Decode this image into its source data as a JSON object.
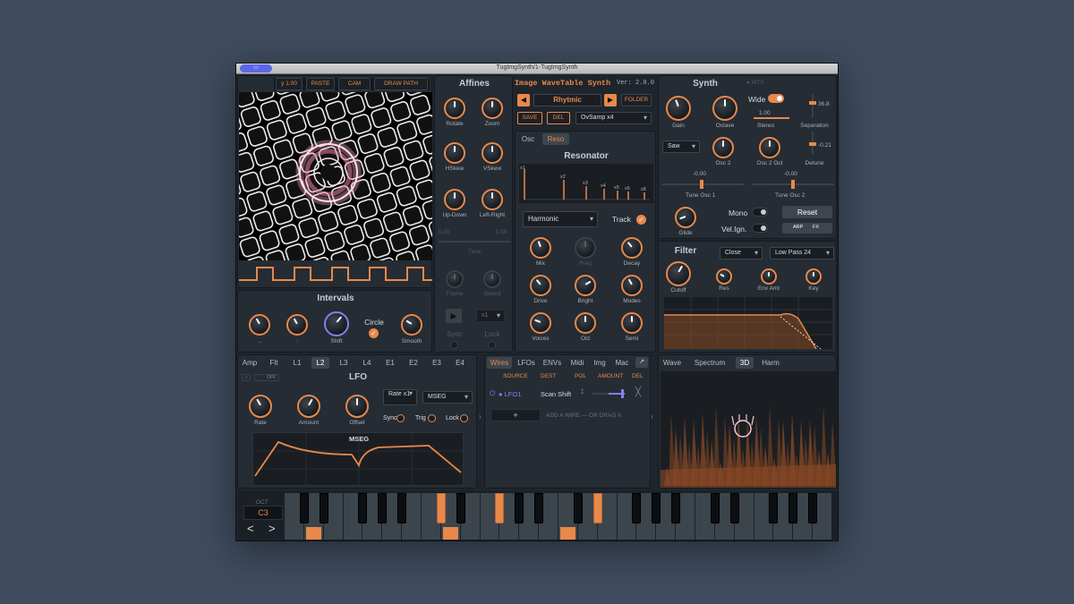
{
  "window": {
    "title": "TugImgSynth/1-TugImgSynth",
    "icon": "app-icon"
  },
  "image_panel": {
    "scale_value": "y 1.00",
    "buttons": [
      "PASTE",
      "CAM",
      "DRAW PATH"
    ]
  },
  "intervals": {
    "title": "Intervals",
    "knobs": [
      "..",
      ":",
      "Shift",
      "Smooth"
    ],
    "circle_label": "Circle"
  },
  "affines": {
    "title": "Affines",
    "knobs": [
      "Rotate",
      "Zoom",
      "HSkew",
      "VSkew",
      "Up-Down",
      "Left-Right"
    ],
    "slider_min": "0.00",
    "slider_max": "1.00",
    "slider_label": "Time",
    "dim_knobs": [
      "Frame",
      "Speed"
    ],
    "multiplier": "x1",
    "sync_label": "Sync",
    "lock_label": "Lock"
  },
  "header": {
    "name": "Image WaveTable Synth",
    "version": "Ver: 2.0.0",
    "preset": "Rhytmic",
    "folder_label": "FOLDER",
    "save_label": "SAVE",
    "del_label": "DEL",
    "oversample": "OvSamp x4"
  },
  "osc_tabs": [
    "Osc",
    "Reso"
  ],
  "resonator": {
    "title": "Resonator",
    "harmonic_labels": [
      "x1",
      "x2",
      "x3",
      "x4",
      "x5",
      "x6",
      "x8"
    ],
    "mode": "Harmonic",
    "track_label": "Track",
    "knobs": [
      "Mix",
      "Freq",
      "Decay",
      "Drive",
      "Bright",
      "Modes",
      "Voices",
      "Oct",
      "Semi"
    ]
  },
  "synth": {
    "title": "Synth",
    "mts_label": "MTS",
    "knobs": [
      "Gain",
      "Octave"
    ],
    "wide_label": "Wide",
    "stereo_value": "1.00",
    "stereo_label": "Stereo",
    "separation_value": "36.8",
    "separation_label": "Separation",
    "detune_value": "-0.21",
    "detune_label": "Detune",
    "wave": "Saw",
    "osc_knobs": [
      "Osc 2",
      "Osc 2 Oct"
    ],
    "tune1_value": "-0.00",
    "tune1_label": "Tune Osc 1",
    "tune2_value": "-0.00",
    "tune2_label": "Tune Osc 2",
    "glide_label": "Glide",
    "mono_label": "Mono",
    "velign_label": "Vel.Ign.",
    "reset_label": "Reset",
    "arp_label": "ARP",
    "fx_label": "FX"
  },
  "filter": {
    "title": "Filter",
    "mode": "Close",
    "type": "Low Pass 24",
    "knobs": [
      "Cutoff",
      "Res",
      "Env Amt",
      "Key"
    ]
  },
  "mod_tabs": [
    "Amp",
    "Flt",
    "L1",
    "L2",
    "L3",
    "L4",
    "E1",
    "E2",
    "E3",
    "E4"
  ],
  "lfo": {
    "title": "LFO",
    "off_label": "OFF",
    "knobs": [
      "Rate",
      "Amount",
      "Offset"
    ],
    "rate_select": "Rate x1",
    "shape_select": "MSEG",
    "sync_label": "Sync",
    "trig_label": "Trig",
    "lock_label": "Lock",
    "mseg_label": "MSEG"
  },
  "matrix": {
    "tabs": [
      "Wires",
      "LFOs",
      "ENVs",
      "Midi",
      "Img",
      "Mac"
    ],
    "columns": [
      "SOURCE",
      "DEST",
      "POL",
      "AMOUNT",
      "DEL"
    ],
    "row": {
      "source": "LFO1",
      "dest": "Scan Shift"
    },
    "add_label": "+",
    "add_hint": "ADD A WIRE  —  OR DRAG A"
  },
  "viz_tabs": [
    "Wave",
    "Spectrum",
    "3D",
    "Harm"
  ],
  "keyboard": {
    "oct_label": "OCT",
    "octave": "C3",
    "prev": "<",
    "next": ">"
  },
  "colors": {
    "accent": "#e8894a",
    "panel": "#252c34",
    "lfo": "#8c7cf0"
  }
}
